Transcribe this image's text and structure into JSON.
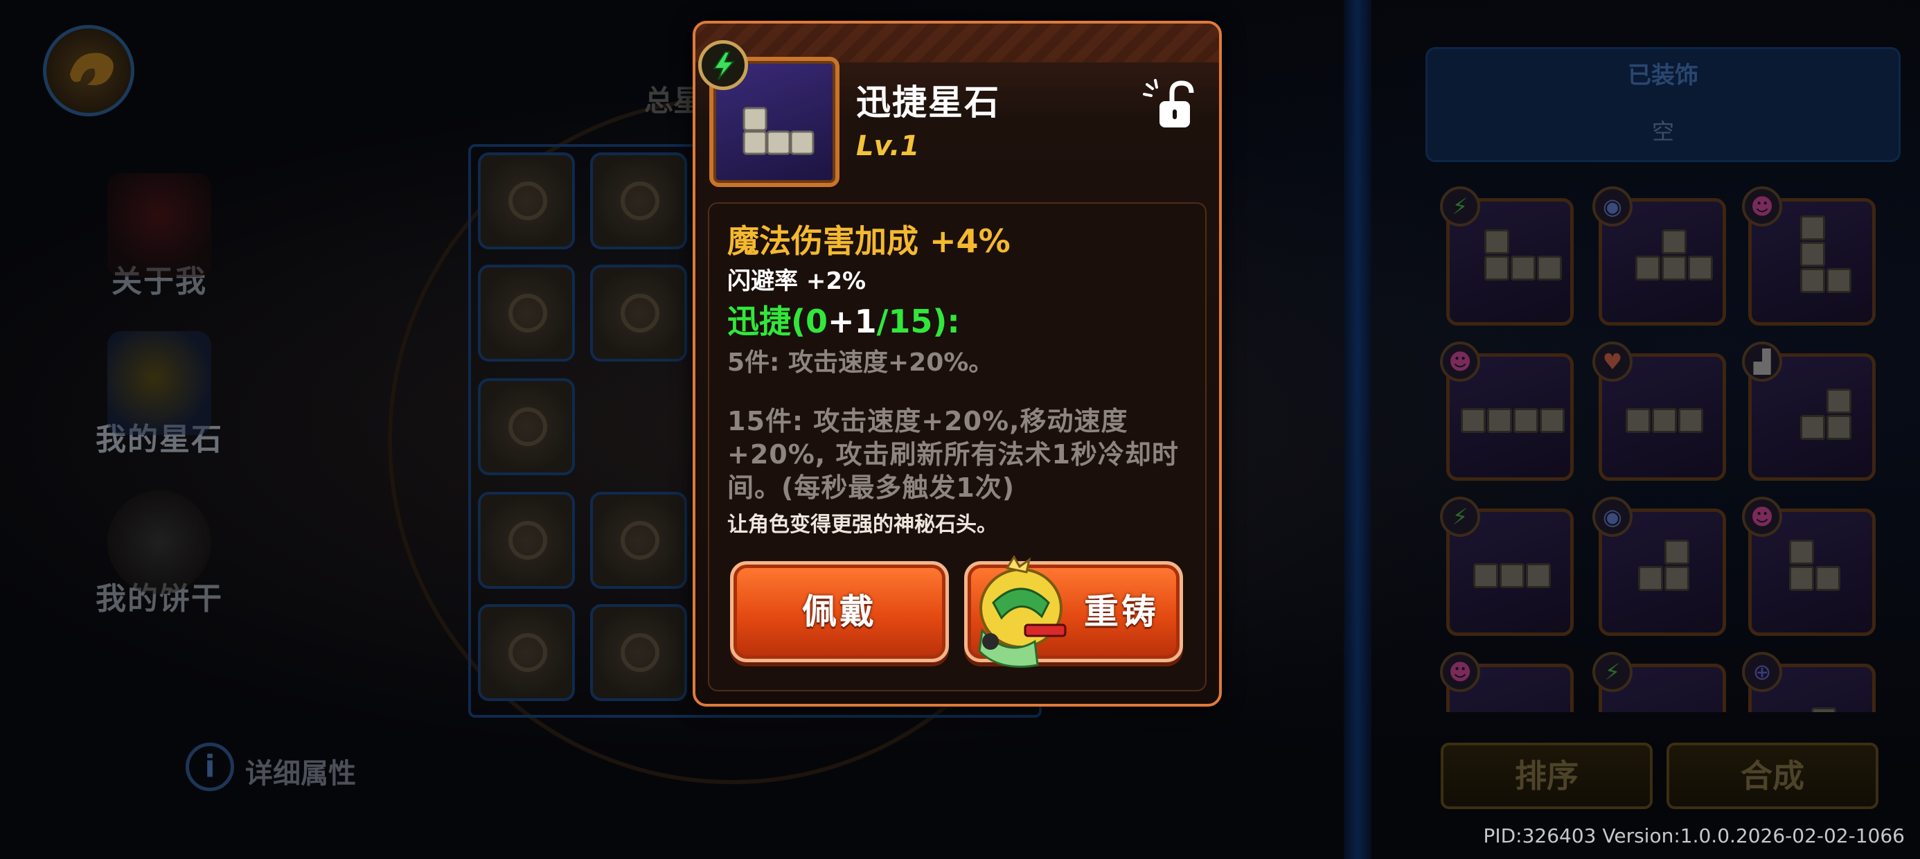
{
  "background": {
    "sidebar": {
      "items": [
        {
          "label": "关于我"
        },
        {
          "label": "我的星石"
        },
        {
          "label": "我的饼干"
        }
      ]
    },
    "total_title_partial": "总星",
    "detail_button": {
      "label": "详细属性"
    },
    "equipped": {
      "title": "已装饰",
      "empty_text": "空"
    },
    "sort_button": {
      "label": "排序"
    },
    "combine_button": {
      "label": "合成"
    },
    "footer": {
      "pid_version": "PID:326403  Version:1.0.0.2026-02-02-1066"
    }
  },
  "popup": {
    "item_name": "迅捷星石",
    "item_level": "Lv.1",
    "stat_main": "魔法伤害加成 +4%",
    "stat_sub": "闪避率 +2%",
    "set_name_prefix": "迅捷(0",
    "set_plus": "+1",
    "set_suffix": "/15):",
    "bonus_5": "5件:  攻击速度+20%。",
    "bonus_15": "15件: 攻击速度+20%,移动速度+20%, 攻击刷新所有法术1秒冷却时间。(每秒最多触发1次)",
    "flavor": "让角色变得更强的神秘石头。",
    "wear_button": "佩戴",
    "recast_button": "重铸"
  },
  "colors": {
    "popup_border": "#e07a3a",
    "stat_main": "#f4b92e",
    "set_green": "#31e83a",
    "level_gold": "#f3c23a",
    "button_orange": "#e44a12"
  }
}
